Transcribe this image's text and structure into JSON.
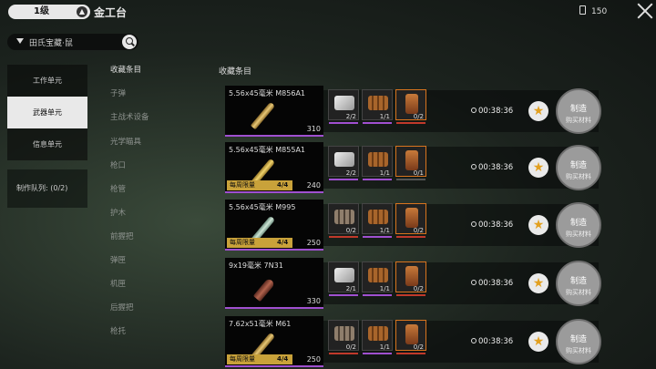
{
  "header": {
    "level": "1级",
    "station": "金工台",
    "currency": "150"
  },
  "search": {
    "text": "田氏宝藏·鼠"
  },
  "tabs": [
    {
      "label": "工作单元",
      "corner": ""
    },
    {
      "label": "武器单元",
      "corner": ""
    },
    {
      "label": "信息单元",
      "corner": ""
    }
  ],
  "queue": {
    "label": "制作队列: (0/2)"
  },
  "categories": [
    "收藏条目",
    "子弹",
    "主战术设备",
    "光学瞄具",
    "枪口",
    "枪管",
    "护木",
    "前握把",
    "弹匣",
    "机匣",
    "后握把",
    "枪托"
  ],
  "section_title": "收藏条目",
  "make": {
    "label": "制造",
    "sub": "购买材料"
  },
  "limit_label": "每周限量",
  "rows": [
    {
      "name": "5.56x45毫米 M856A1",
      "count": "310",
      "limit": "",
      "limit_value": "",
      "timer": "00:38:36",
      "mats": [
        "2/2",
        "1/1",
        "0/2"
      ]
    },
    {
      "name": "5.56x45毫米 M855A1",
      "count": "240",
      "limit": "每周限量",
      "limit_value": "4/4",
      "timer": "00:38:36",
      "mats": [
        "2/2",
        "1/1",
        "0/1"
      ]
    },
    {
      "name": "5.56x45毫米 M995",
      "count": "250",
      "limit": "每周限量",
      "limit_value": "4/4",
      "timer": "00:38:36",
      "mats": [
        "0/2",
        "1/1",
        "0/2"
      ]
    },
    {
      "name": "9x19毫米 7N31",
      "count": "330",
      "limit": "",
      "limit_value": "",
      "timer": "00:38:36",
      "mats": [
        "2/1",
        "1/1",
        "0/2"
      ]
    },
    {
      "name": "7.62x51毫米 M61",
      "count": "250",
      "limit": "每周限量",
      "limit_value": "4/4",
      "timer": "00:38:36",
      "mats": [
        "0/2",
        "1/1",
        "0/2"
      ]
    }
  ]
}
